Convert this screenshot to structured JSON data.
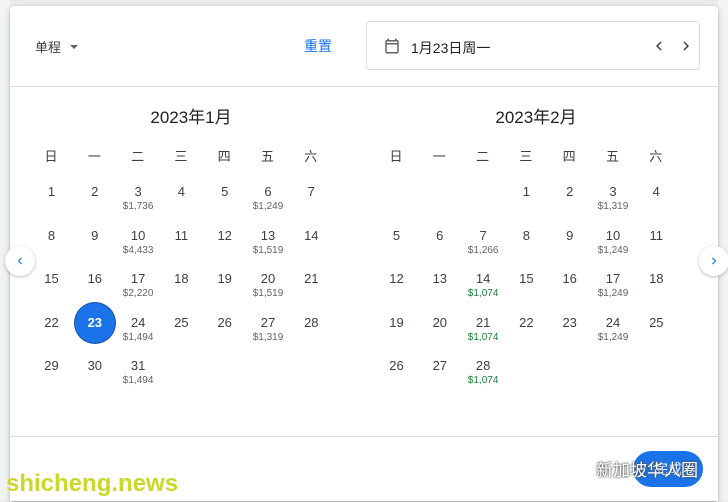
{
  "header": {
    "trip_type": "单程",
    "reset": "重置",
    "date_value": "1月23日周一"
  },
  "months": [
    {
      "title": "2023年1月",
      "weekdays": [
        "日",
        "一",
        "二",
        "三",
        "四",
        "五",
        "六"
      ],
      "weeks": [
        [
          {
            "d": "1"
          },
          {
            "d": "2"
          },
          {
            "d": "3",
            "p": "$1,736"
          },
          {
            "d": "4"
          },
          {
            "d": "5"
          },
          {
            "d": "6",
            "p": "$1,249"
          },
          {
            "d": "7"
          }
        ],
        [
          {
            "d": "8"
          },
          {
            "d": "9"
          },
          {
            "d": "10",
            "p": "$4,433"
          },
          {
            "d": "11"
          },
          {
            "d": "12"
          },
          {
            "d": "13",
            "p": "$1,519"
          },
          {
            "d": "14"
          }
        ],
        [
          {
            "d": "15"
          },
          {
            "d": "16"
          },
          {
            "d": "17",
            "p": "$2,220"
          },
          {
            "d": "18"
          },
          {
            "d": "19"
          },
          {
            "d": "20",
            "p": "$1,519"
          },
          {
            "d": "21"
          }
        ],
        [
          {
            "d": "22"
          },
          {
            "d": "23",
            "sel": true
          },
          {
            "d": "24",
            "p": "$1,494"
          },
          {
            "d": "25"
          },
          {
            "d": "26"
          },
          {
            "d": "27",
            "p": "$1,319"
          },
          {
            "d": "28"
          }
        ],
        [
          {
            "d": "29"
          },
          {
            "d": "30"
          },
          {
            "d": "31",
            "p": "$1,494"
          },
          null,
          null,
          null,
          null
        ]
      ]
    },
    {
      "title": "2023年2月",
      "weekdays": [
        "日",
        "一",
        "二",
        "三",
        "四",
        "五",
        "六"
      ],
      "weeks": [
        [
          null,
          null,
          null,
          {
            "d": "1"
          },
          {
            "d": "2"
          },
          {
            "d": "3",
            "p": "$1,319"
          },
          {
            "d": "4"
          }
        ],
        [
          {
            "d": "5"
          },
          {
            "d": "6"
          },
          {
            "d": "7",
            "p": "$1,266"
          },
          {
            "d": "8"
          },
          {
            "d": "9"
          },
          {
            "d": "10",
            "p": "$1,249"
          },
          {
            "d": "11"
          }
        ],
        [
          {
            "d": "12"
          },
          {
            "d": "13"
          },
          {
            "d": "14",
            "p": "$1,074",
            "low": true
          },
          {
            "d": "15"
          },
          {
            "d": "16"
          },
          {
            "d": "17",
            "p": "$1,249"
          },
          {
            "d": "18"
          }
        ],
        [
          {
            "d": "19"
          },
          {
            "d": "20"
          },
          {
            "d": "21",
            "p": "$1,074",
            "low": true
          },
          {
            "d": "22"
          },
          {
            "d": "23"
          },
          {
            "d": "24",
            "p": "$1,249"
          },
          {
            "d": "25"
          }
        ],
        [
          {
            "d": "26"
          },
          {
            "d": "27"
          },
          {
            "d": "28",
            "p": "$1,074",
            "low": true
          },
          null,
          null,
          null,
          null
        ]
      ]
    }
  ],
  "footer": {
    "done": "完成"
  },
  "watermarks": {
    "left": "shicheng.news",
    "right": "新加坡华人圈"
  },
  "colors": {
    "accent": "#1a73e8",
    "low_price": "#188038",
    "watermark_left": "#c9d82a"
  },
  "icons": {
    "date_field": "calendar-icon",
    "prev": "chevron-left-icon",
    "next": "chevron-right-icon",
    "wechat": "wechat-icon"
  }
}
